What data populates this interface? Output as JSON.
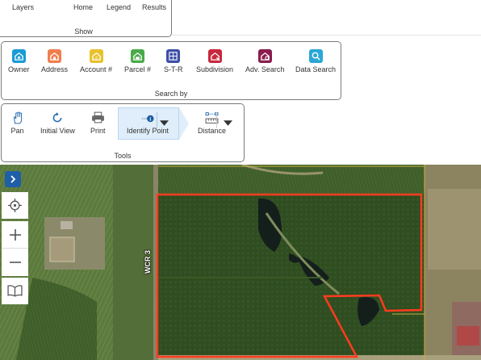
{
  "show": {
    "title": "Show",
    "items": [
      {
        "label": "Layers",
        "icon": "layers-icon"
      },
      {
        "label": "Home",
        "icon": "home-icon"
      },
      {
        "label": "Legend",
        "icon": "legend-icon"
      },
      {
        "label": "Results",
        "icon": "results-icon"
      }
    ]
  },
  "search": {
    "title": "Search by",
    "items": [
      {
        "label": "Owner",
        "icon": "owner-search-icon",
        "color": "#1a9bd7"
      },
      {
        "label": "Address",
        "icon": "address-search-icon",
        "color": "#f07e4f"
      },
      {
        "label": "Account #",
        "icon": "account-search-icon",
        "color": "#e8c12c"
      },
      {
        "label": "Parcel #",
        "icon": "parcel-search-icon",
        "color": "#4aaa4a"
      },
      {
        "label": "S-T-R",
        "icon": "str-search-icon",
        "color": "#3d4fa8"
      },
      {
        "label": "Subdivision",
        "icon": "subdivision-search-icon",
        "color": "#c8283c"
      },
      {
        "label": "Adv. Search",
        "icon": "advanced-search-icon",
        "color": "#8a1d4e"
      },
      {
        "label": "Data Search",
        "icon": "data-search-icon",
        "color": "#2aa7d6"
      }
    ]
  },
  "tools": {
    "title": "Tools",
    "items": [
      {
        "label": "Pan",
        "icon": "pan-hand-icon"
      },
      {
        "label": "Initial View",
        "icon": "initial-view-icon"
      },
      {
        "label": "Print",
        "icon": "print-icon"
      },
      {
        "label": "Identify Point",
        "icon": "identify-point-icon"
      },
      {
        "label": "Distance",
        "icon": "distance-icon"
      }
    ]
  },
  "map": {
    "road_label": "WCR 3",
    "parcel_color": "#ff3b1f"
  }
}
